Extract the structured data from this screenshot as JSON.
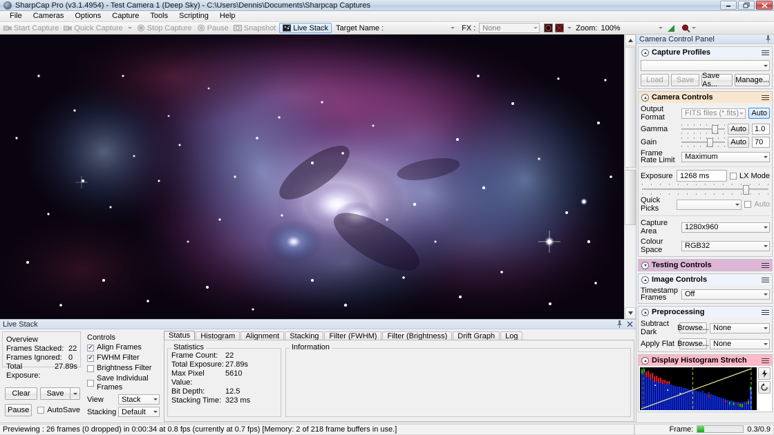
{
  "window": {
    "title": "SharpCap Pro (v3.1.4954) - Test Camera 1 (Deep Sky) - C:\\Users\\Dennis\\Documents\\Sharpcap Captures",
    "minimize_label": "Minimize",
    "restore_label": "Restore",
    "close_label": "Close"
  },
  "menu": {
    "items": [
      "File",
      "Cameras",
      "Options",
      "Capture",
      "Tools",
      "Scripting",
      "Help"
    ]
  },
  "toolbar": {
    "start_capture": "Start Capture",
    "quick_capture": "Quick Capture",
    "stop_capture": "Stop Capture",
    "pause": "Pause",
    "snapshot": "Snapshot",
    "live_stack": "Live Stack",
    "target_name_label": "Target Name :",
    "target_name_value": "",
    "fx_label": "FX :",
    "fx_value": "None",
    "zoom_label": "Zoom:",
    "zoom_value": "100%"
  },
  "live_stack": {
    "panel_title": "Live Stack",
    "overview_label": "Overview",
    "overview": [
      {
        "key": "Frames Stacked:",
        "value": "22"
      },
      {
        "key": "Frames Ignored:",
        "value": "0"
      },
      {
        "key": "Total Exposure:",
        "value": "27.89s"
      }
    ],
    "clear_button": "Clear",
    "save_button": "Save",
    "pause_button": "Pause",
    "autosave_label": "AutoSave",
    "autosave_checked": false,
    "controls_label": "Controls",
    "checkboxes": [
      {
        "label": "Align Frames",
        "checked": true
      },
      {
        "label": "FWHM Filter",
        "checked": true
      },
      {
        "label": "Brightness Filter",
        "checked": false
      },
      {
        "label": "Save Individual Frames",
        "checked": false
      }
    ],
    "view_label": "View",
    "view_value": "Stack",
    "stacking_label": "Stacking",
    "stacking_value": "Default",
    "tabs": [
      "Status",
      "Histogram",
      "Alignment",
      "Stacking",
      "Filter (FWHM)",
      "Filter (Brightness)",
      "Drift Graph",
      "Log"
    ],
    "active_tab": "Status",
    "statistics_label": "Statistics",
    "statistics": [
      {
        "key": "Frame Count:",
        "value": "22"
      },
      {
        "key": "Total Exposure:",
        "value": "27.89s"
      },
      {
        "key": "Max Pixel Value:",
        "value": "5610"
      },
      {
        "key": "Bit Depth:",
        "value": "12.5"
      },
      {
        "key": "Stacking Time:",
        "value": "323 ms"
      }
    ],
    "information_label": "Information",
    "information_text": ""
  },
  "camera_panel": {
    "title": "Camera Control Panel",
    "capture_profiles": {
      "title": "Capture Profiles",
      "profile_value": "",
      "load_button": "Load",
      "save_button": "Save",
      "save_as_button": "Save As...",
      "manage_button": "Manage..."
    },
    "camera_controls": {
      "title": "Camera Controls",
      "output_format_label": "Output Format",
      "output_format_value": "FITS files (*.fits)",
      "output_format_auto": "Auto",
      "gamma_label": "Gamma",
      "gamma_auto": "Auto",
      "gamma_value": "1.0",
      "gain_label": "Gain",
      "gain_auto": "Auto",
      "gain_value": "70",
      "frame_rate_limit_label": "Frame Rate Limit",
      "frame_rate_limit_value": "Maximum",
      "exposure_label": "Exposure",
      "exposure_value": "1268 ms",
      "lx_mode_label": "LX Mode",
      "lx_mode_checked": false,
      "quick_picks_label": "Quick Picks",
      "quick_picks_value": "",
      "exposure_auto_label": "Auto",
      "exposure_auto_checked": false,
      "capture_area_label": "Capture Area",
      "capture_area_value": "1280x960",
      "colour_space_label": "Colour Space",
      "colour_space_value": "RGB32"
    },
    "testing_controls": {
      "title": "Testing Controls"
    },
    "image_controls": {
      "title": "Image Controls",
      "timestamp_frames_label": "Timestamp Frames",
      "timestamp_frames_value": "Off"
    },
    "preprocessing": {
      "title": "Preprocessing",
      "subtract_dark_label": "Subtract Dark",
      "subtract_dark_browse": "Browse...",
      "subtract_dark_value": "None",
      "apply_flat_label": "Apply Flat",
      "apply_flat_browse": "Browse...",
      "apply_flat_value": "None"
    },
    "display_histogram": {
      "title": "Display Histogram Stretch",
      "auto_stretch_icon": "lightning-icon",
      "reset_icon": "reset-icon"
    }
  },
  "status_bar": {
    "message": "Previewing : 26 frames (0 dropped) in 0:00:34 at 0.8 fps  (currently at 0.7 fps) [Memory: 2 of 218 frame buffers in use.]",
    "frame_label": "Frame:",
    "frame_value": "0.3/0.9",
    "frame_progress_percent": 14
  },
  "colors": {
    "section_testing": "#ddb6d9",
    "section_histogram": "#ffb9c8",
    "section_camera_controls": "#fae6cf",
    "section_default": "#eef2fb",
    "accent_blue": "#3b87d6"
  }
}
